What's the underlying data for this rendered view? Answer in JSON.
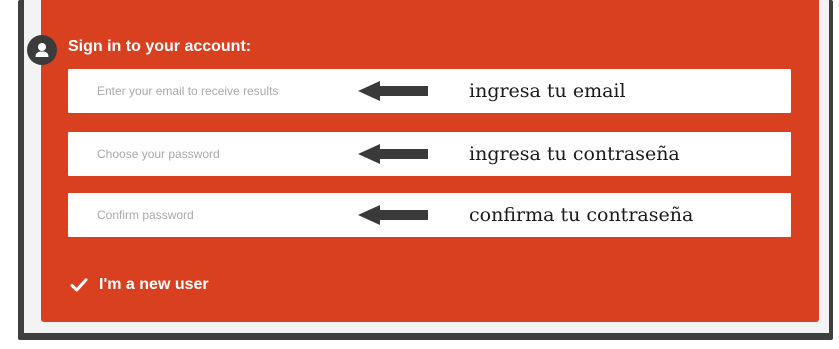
{
  "form": {
    "heading": "Sign in to your account:",
    "fields": [
      {
        "placeholder": "Enter your email to receive results",
        "value": "",
        "annotation": "ingresa tu email"
      },
      {
        "placeholder": "Choose your password",
        "value": "",
        "annotation": "ingresa tu contraseña"
      },
      {
        "placeholder": "Confirm password",
        "value": "",
        "annotation": "confirma tu contraseña"
      }
    ],
    "new_user_label": "I'm a new user",
    "new_user_checked": true
  },
  "icons": {
    "avatar": "user-icon",
    "arrow": "arrow-left-icon",
    "checkbox": "checkmark-icon"
  },
  "colors": {
    "panel": "#d9401f",
    "field_background": "#ffffff",
    "placeholder": "#a9a9a9",
    "avatar_background": "#3b3b3b",
    "arrow": "#3a3a3a",
    "annotation_text": "#1a1a1a"
  }
}
